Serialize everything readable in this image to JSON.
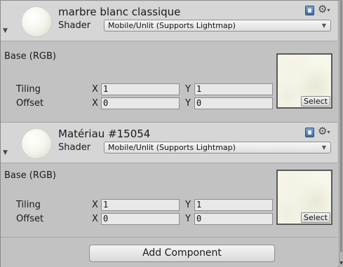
{
  "materials": [
    {
      "name": "marbre blanc classique",
      "shader_label": "Shader",
      "shader_value": "Mobile/Unlit (Supports Lightmap)",
      "base_label": "Base (RGB)",
      "tiling_label": "Tiling",
      "offset_label": "Offset",
      "x_axis": "X",
      "y_axis": "Y",
      "tiling_x": "1",
      "tiling_y": "1",
      "offset_x": "0",
      "offset_y": "0",
      "select_label": "Select"
    },
    {
      "name": "Matériau #15054",
      "shader_label": "Shader",
      "shader_value": "Mobile/Unlit (Supports Lightmap)",
      "base_label": "Base (RGB)",
      "tiling_label": "Tiling",
      "offset_label": "Offset",
      "x_axis": "X",
      "y_axis": "Y",
      "tiling_x": "1",
      "tiling_y": "1",
      "offset_x": "0",
      "offset_y": "0",
      "select_label": "Select"
    }
  ],
  "footer": {
    "add_component_label": "Add Component"
  },
  "icons": {
    "help": "help-book-icon",
    "settings": "gear-icon",
    "dropdown": "chevron-down-icon",
    "foldout": "foldout-arrow-icon"
  }
}
